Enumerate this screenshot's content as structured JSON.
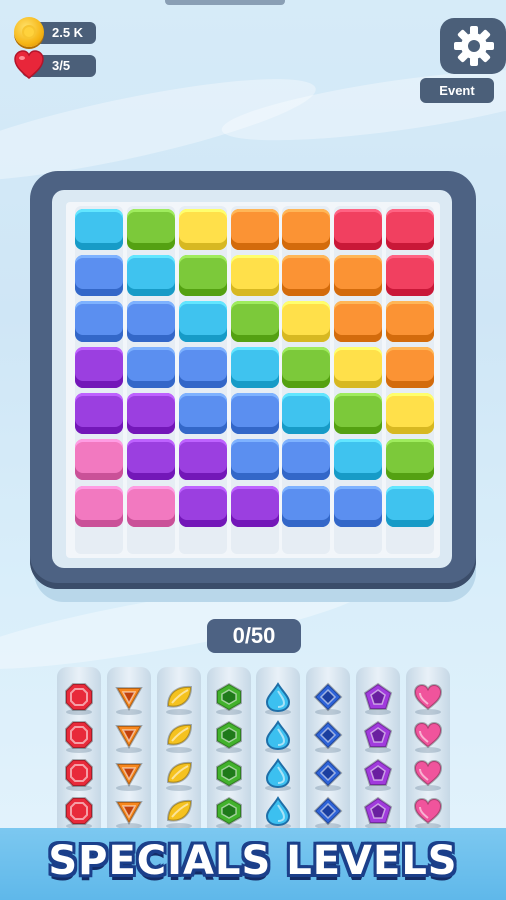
{
  "hud": {
    "coins": "2.5 K",
    "lives": "3/5",
    "event_label": "Event",
    "coin_icon": "coin-icon",
    "heart_icon": "heart-icon",
    "settings_icon": "gear-icon"
  },
  "board": {
    "columns": [
      [
        "cyan",
        "blue",
        "blue",
        "purple",
        "purple",
        "pink",
        "pink"
      ],
      [
        "green",
        "cyan",
        "blue",
        "blue",
        "purple",
        "purple",
        "pink"
      ],
      [
        "yellow",
        "green",
        "cyan",
        "blue",
        "blue",
        "purple",
        "purple"
      ],
      [
        "orange",
        "yellow",
        "green",
        "cyan",
        "blue",
        "blue",
        "purple"
      ],
      [
        "orange",
        "orange",
        "yellow",
        "green",
        "cyan",
        "blue",
        "blue"
      ],
      [
        "red",
        "orange",
        "orange",
        "yellow",
        "green",
        "cyan",
        "blue"
      ],
      [
        "red",
        "red",
        "orange",
        "orange",
        "yellow",
        "green",
        "cyan"
      ]
    ],
    "colors": {
      "cyan": "#3fc3ef",
      "blue": "#5b8ff0",
      "purple": "#9b3fe0",
      "pink": "#f279c0",
      "green": "#7cc93a",
      "yellow": "#ffe04a",
      "orange": "#fb9334",
      "red": "#f14060"
    }
  },
  "progress": {
    "label": "0/50",
    "current": 0,
    "total": 50
  },
  "gem_tubes": [
    {
      "gem": "red-octagon-gem",
      "color": "#e82a3a",
      "count": 4
    },
    {
      "gem": "orange-triangle-gem",
      "color": "#f7861c",
      "count": 4
    },
    {
      "gem": "yellow-leaf-gem",
      "color": "#f5c21f",
      "count": 4
    },
    {
      "gem": "green-hexagon-gem",
      "color": "#42b22c",
      "count": 4
    },
    {
      "gem": "cyan-drop-gem",
      "color": "#3cc0f0",
      "count": 4
    },
    {
      "gem": "blue-diamond-gem",
      "color": "#2e63d8",
      "count": 4
    },
    {
      "gem": "purple-pentagon-gem",
      "color": "#a13bdd",
      "count": 4
    },
    {
      "gem": "pink-heart-gem",
      "color": "#f0549c",
      "count": 4
    }
  ],
  "banner": {
    "text": "SPECIALS LEVELS"
  }
}
